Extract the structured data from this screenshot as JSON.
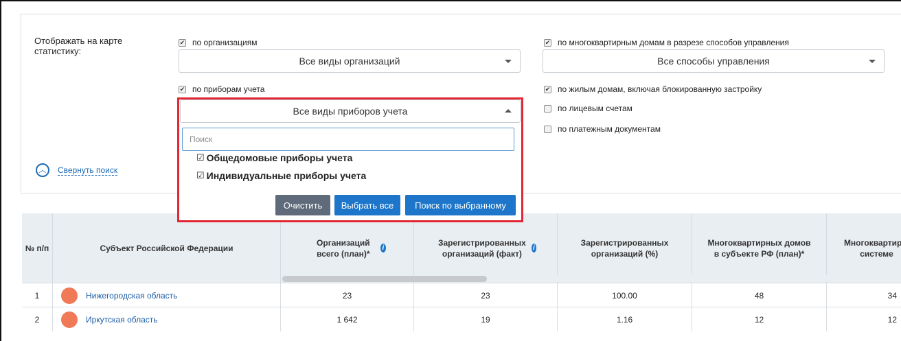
{
  "filters": {
    "stat_label": "Отображать на карте статистику:",
    "by_orgs_label": "по организациям",
    "org_types_value": "Все виды организаций",
    "by_meters_label": "по приборам учета",
    "meter_types_value": "Все виды приборов учета",
    "by_mkd_label": "по многоквартирным домам в разрезе способов управления",
    "mgmt_value": "Все способы управления",
    "by_houses_label": "по жилым домам, включая блокированную застройку",
    "by_accounts_label": "по лицевым счетам",
    "by_payments_label": "по платежным документам",
    "collapse_label": "Свернуть поиск"
  },
  "dropdown": {
    "search_placeholder": "Поиск",
    "options": [
      {
        "label": "Общедомовые приборы учета",
        "checked": true
      },
      {
        "label": "Индивидуальные приборы учета",
        "checked": true
      }
    ],
    "btn_clear": "Очистить",
    "btn_select_all": "Выбрать все",
    "btn_search_selected": "Поиск по выбранному"
  },
  "table": {
    "headers": {
      "num": "№ п/п",
      "subject": "Субъект Российской Федерации",
      "orgs_total": "Организаций всего (план)*",
      "orgs_fact": "Зарегистрированных организаций (факт)",
      "orgs_pct": "Зарегистрированных организаций (%)",
      "mkd_plan": "Многоквартирных домов в субъекте РФ (план)*",
      "mkd_system": "Многоквартир в системе"
    },
    "rows": [
      {
        "num": "1",
        "region": "Нижегородская область",
        "orgs_total": "23",
        "orgs_fact": "23",
        "orgs_pct": "100.00",
        "mkd_plan": "48",
        "mkd_system": "34"
      },
      {
        "num": "2",
        "region": "Иркутская область",
        "orgs_total": "1 642",
        "orgs_fact": "19",
        "orgs_pct": "1.16",
        "mkd_plan": "12",
        "mkd_system": "12"
      }
    ]
  },
  "colors": {
    "highlight": "#e32633",
    "accent": "#1d76c9",
    "region_dot": "#f07a57"
  }
}
